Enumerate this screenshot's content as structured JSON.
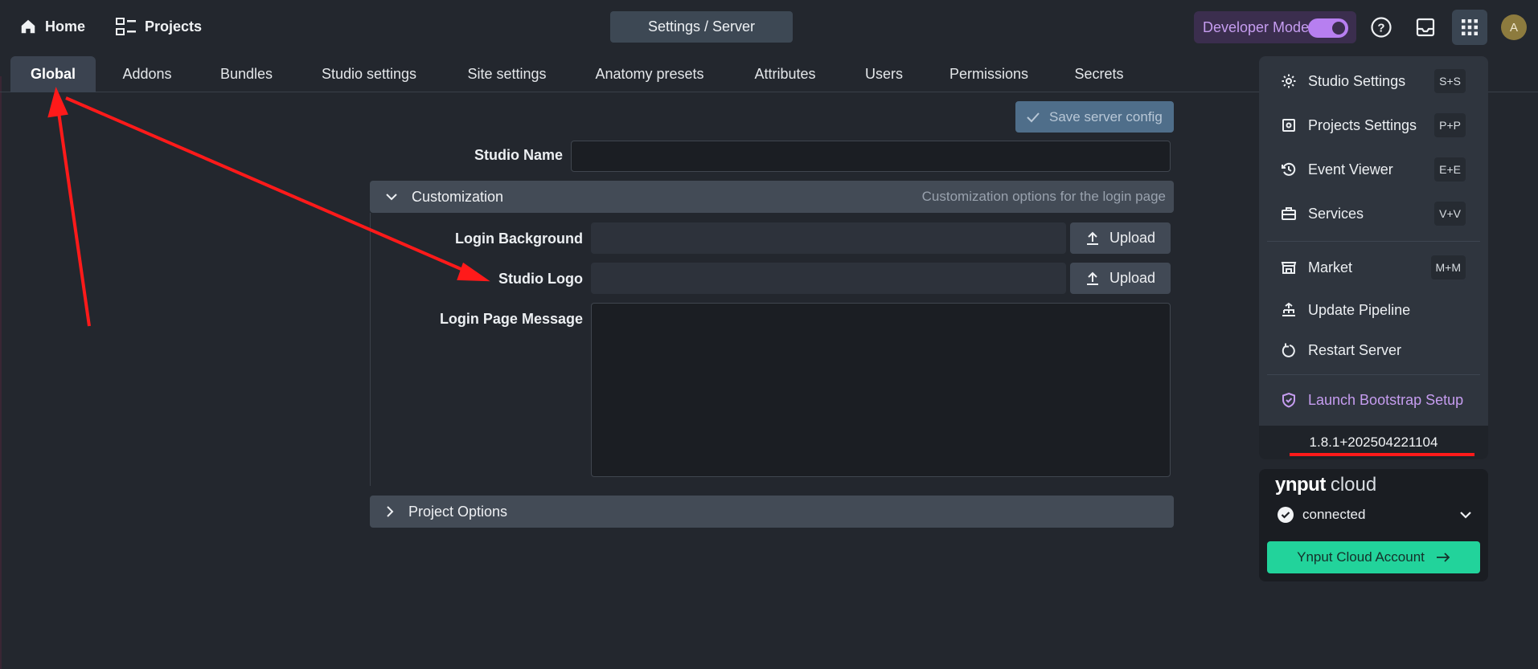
{
  "nav": {
    "home_label": "Home",
    "projects_label": "Projects"
  },
  "page_title": "Settings / Server",
  "developer_mode": {
    "label": "Developer Mode",
    "enabled": true
  },
  "user": {
    "avatar_initial": "A"
  },
  "tabs": [
    {
      "label": "Global",
      "active": true
    },
    {
      "label": "Addons"
    },
    {
      "label": "Bundles"
    },
    {
      "label": "Studio settings"
    },
    {
      "label": "Site settings"
    },
    {
      "label": "Anatomy presets"
    },
    {
      "label": "Attributes"
    },
    {
      "label": "Users"
    },
    {
      "label": "Permissions"
    },
    {
      "label": "Secrets"
    }
  ],
  "form": {
    "save_label": "Save server config",
    "studio_name_label": "Studio Name",
    "studio_name_value": "",
    "customization": {
      "title": "Customization",
      "description": "Customization options for the login page",
      "expanded": true
    },
    "login_background_label": "Login Background",
    "studio_logo_label": "Studio Logo",
    "upload_label": "Upload",
    "login_message_label": "Login Page Message",
    "project_options": {
      "title": "Project Options",
      "expanded": false
    }
  },
  "app_menu": {
    "items": [
      {
        "label": "Studio Settings",
        "shortcut": "S+S",
        "icon": "gear-icon"
      },
      {
        "label": "Projects Settings",
        "shortcut": "P+P",
        "icon": "settings-square-icon"
      },
      {
        "label": "Event Viewer",
        "shortcut": "E+E",
        "icon": "history-icon"
      },
      {
        "label": "Services",
        "shortcut": "V+V",
        "icon": "briefcase-icon"
      },
      {
        "label": "Market",
        "shortcut": "M+M",
        "icon": "store-icon"
      },
      {
        "label": "Update Pipeline",
        "icon": "pipeline-icon"
      },
      {
        "label": "Restart Server",
        "icon": "restart-icon"
      },
      {
        "label": "Launch Bootstrap Setup",
        "icon": "shield-check-icon"
      }
    ],
    "version": "1.8.1+202504221104"
  },
  "cloud": {
    "brand": "ynput",
    "brand_suffix": "cloud",
    "status": "connected",
    "account_button": "Ynput Cloud Account"
  },
  "colors": {
    "accent_purple": "#c69df0",
    "cloud_green": "#22d39b",
    "annotation_red": "#ff1a1a"
  }
}
